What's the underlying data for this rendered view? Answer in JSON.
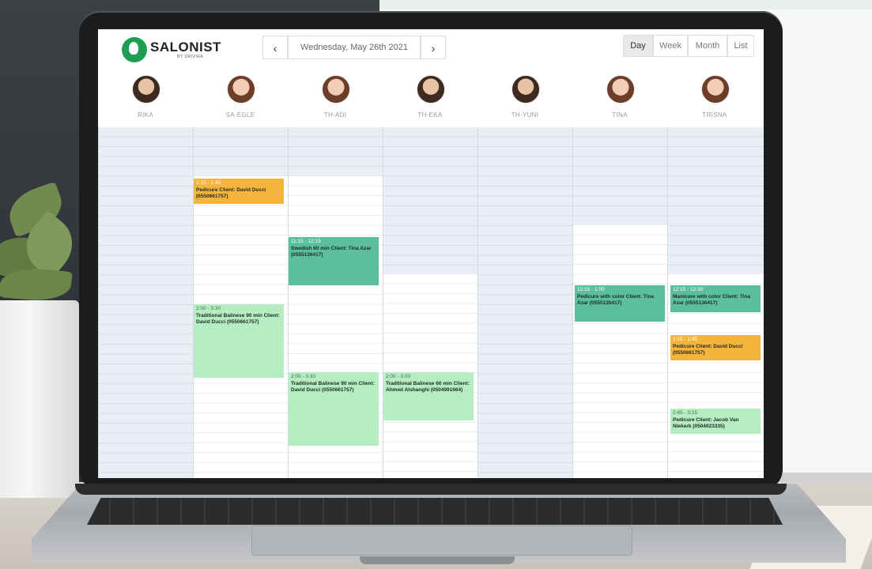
{
  "app": {
    "brand": "SALONIST",
    "brand_sub": "BY DRIVIRA"
  },
  "nav": {
    "prev_label": "‹",
    "next_label": "›",
    "date": "Wednesday, May 26th 2021"
  },
  "views": [
    {
      "label": "Day",
      "active": true
    },
    {
      "label": "Week",
      "active": false
    },
    {
      "label": "Month",
      "active": false
    },
    {
      "label": "List",
      "active": false
    }
  ],
  "staff": [
    "RIKA",
    "SA-EGLE",
    "TH-ADI",
    "TH-EKA",
    "TH-YUNI",
    "TINA",
    "TRISNA"
  ],
  "appointments": [
    {
      "staff": "SA-EGLE",
      "time": "1:15 - 1:45",
      "details": "Pedicure Client: David Ducci (0550661757)",
      "color": "#f4b53e"
    },
    {
      "staff": "SA-EGLE",
      "time": "2:00 - 3:30",
      "details": "Traditional Balinese 90 min Client: David Ducci (0550661757)",
      "color": "#b5ecc2"
    },
    {
      "staff": "TH-ADI",
      "time": "11:15 - 12:15",
      "details": "Swedish 60 min Client: Tina Azar (0555136417)",
      "color": "#5bbf9f"
    },
    {
      "staff": "TH-ADI",
      "time": "2:00 - 3:30",
      "details": "Traditional Balinese 90 min Client: David Ducci (0550661757)",
      "color": "#b5ecc2"
    },
    {
      "staff": "TH-EKA",
      "time": "2:00 - 3:00",
      "details": "Traditional Balinese 60 min Client: Ahmed Alshanghi (0504991664)",
      "color": "#b5ecc2"
    },
    {
      "staff": "TINA",
      "time": "12:15 - 1:00",
      "details": "Pedicure with color Client: Tina Azar (0555136417)",
      "color": "#5bbf9f"
    },
    {
      "staff": "TRISNA",
      "time": "12:15 - 12:30",
      "details": "Manicure with color Client: Tina Azar (0555136417)",
      "color": "#5bbf9f"
    },
    {
      "staff": "TRISNA",
      "time": "1:15 - 1:45",
      "details": "Pedicure Client: David Ducci (0550661757)",
      "color": "#f4b53e"
    },
    {
      "staff": "TRISNA",
      "time": "2:45 - 3:15",
      "details": "Pedicure Client: Jacob Van Niekerk (0504923335)",
      "color": "#b5ecc2"
    }
  ]
}
